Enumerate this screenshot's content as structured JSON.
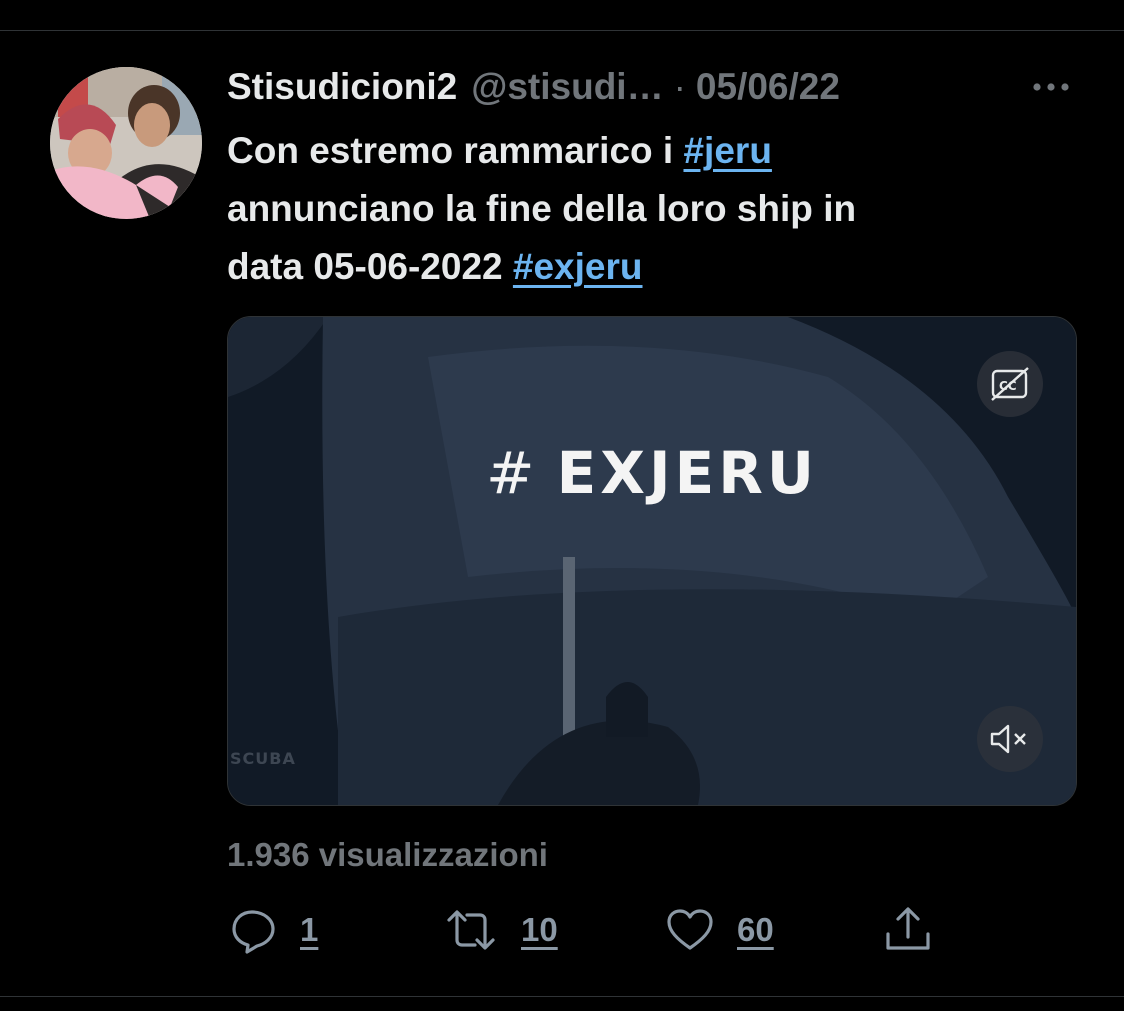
{
  "tweet": {
    "display_name": "Stisudicioni2",
    "handle": "@stisudi…",
    "separator": "·",
    "date": "05/06/22",
    "text": {
      "line1_prefix": "Con estremo rammarico i ",
      "hashtag1": "#jeru",
      "line2": "annunciano la fine della loro ship in",
      "line3_prefix": "data 05-06-2022 ",
      "hashtag2": "#exjeru"
    },
    "media": {
      "overlay_hash": "#",
      "overlay_word": "EXJERU",
      "watermark": "SCUBA"
    },
    "views": "1.936 visualizzazioni",
    "actions": {
      "replies": "1",
      "retweets": "10",
      "likes": "60"
    }
  },
  "icons": {
    "more": "more-icon",
    "captions": "captions-off-icon",
    "mute": "mute-icon",
    "reply": "reply-icon",
    "retweet": "retweet-icon",
    "like": "heart-icon",
    "share": "share-icon"
  },
  "colors": {
    "background": "#000000",
    "text_primary": "#e7e9ea",
    "text_secondary": "#71767b",
    "link": "#6cb4f0",
    "divider": "#2f3336"
  }
}
